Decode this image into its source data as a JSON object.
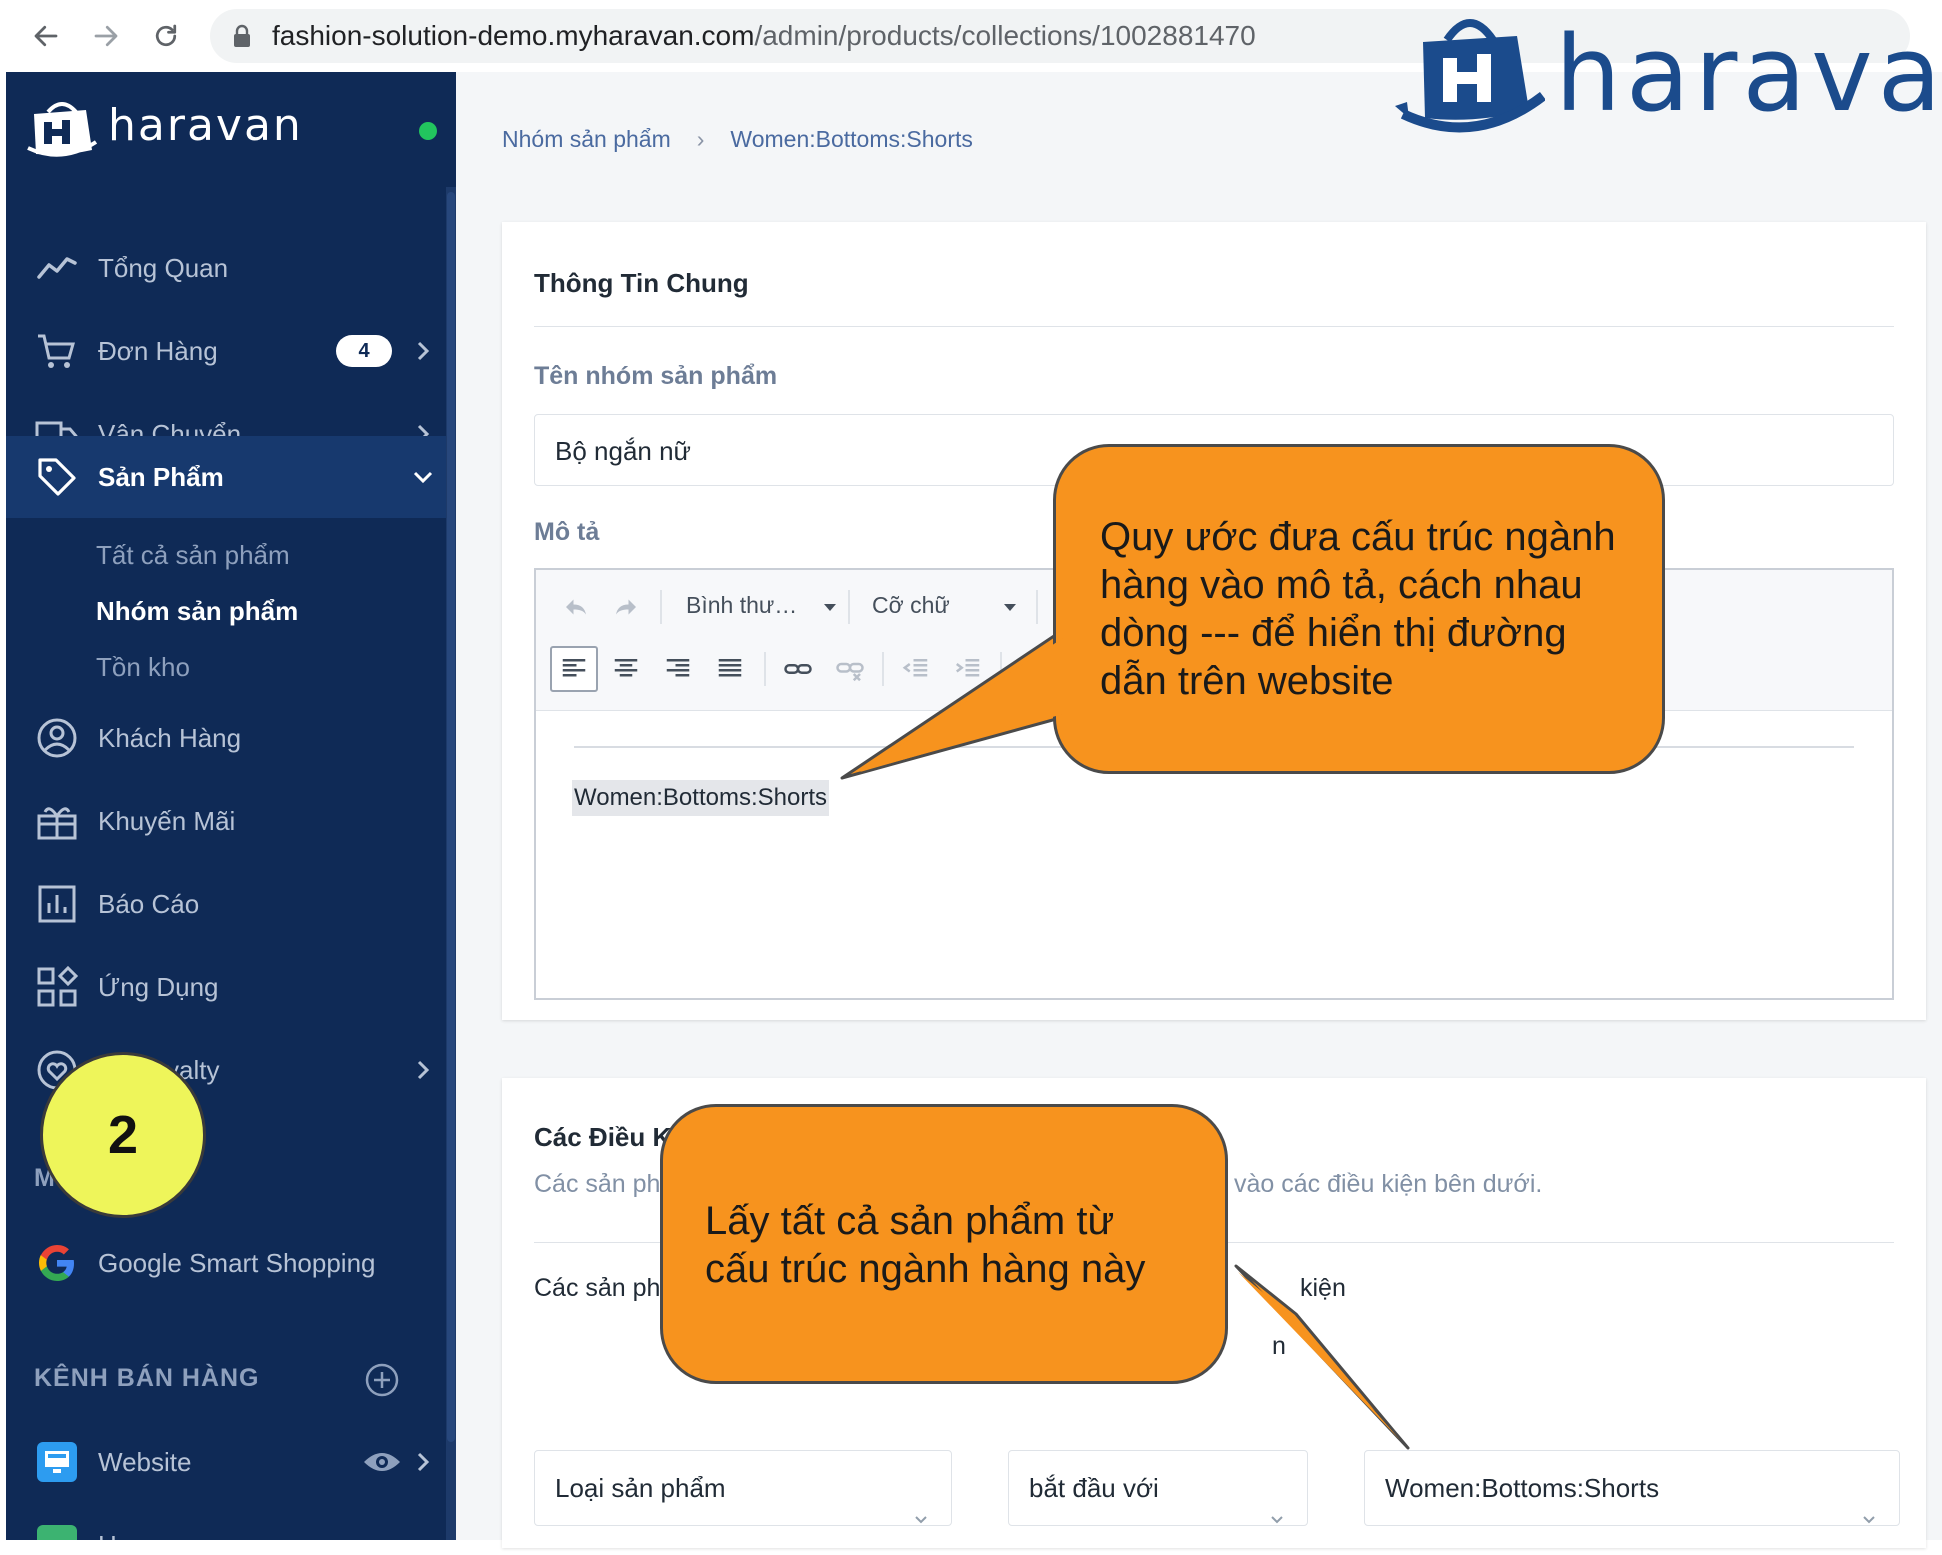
{
  "browser": {
    "url_host": "fashion-solution-demo.myharavan.com",
    "url_path": "/admin/products/collections/1002881470"
  },
  "brand": {
    "name": "haravan",
    "color": "#1b4b8c"
  },
  "sidebar": {
    "logo_text": "haravan",
    "status_color": "#22c55e",
    "items": [
      {
        "label": "Tổng Quan",
        "icon": "chart-line-icon"
      },
      {
        "label": "Đơn Hàng",
        "icon": "cart-icon",
        "badge": "4"
      },
      {
        "label": "Vận Chuyển",
        "icon": "truck-icon"
      },
      {
        "label": "Sản Phẩm",
        "icon": "tag-icon",
        "active": true
      },
      {
        "label": "Khách Hàng",
        "icon": "user-circle-icon"
      },
      {
        "label": "Khuyến Mãi",
        "icon": "gift-icon"
      },
      {
        "label": "Báo Cáo",
        "icon": "report-icon"
      },
      {
        "label": "Ứng Dụng",
        "icon": "apps-icon"
      },
      {
        "label": "yalty",
        "icon": "heart-icon"
      },
      {
        "label": "Google Smart Shopping",
        "icon": "google-icon"
      },
      {
        "label": "Website",
        "icon": "website-icon"
      },
      {
        "label": "Haravan...",
        "icon": "store-icon"
      }
    ],
    "sub_items": [
      "Tất cả sản phẩm",
      "Nhóm sản phẩm",
      "Tồn kho"
    ],
    "partial_section": "M",
    "sales_channels": "KÊNH BÁN HÀNG"
  },
  "breadcrumb": {
    "parent": "Nhóm sản phẩm",
    "current": "Women:Bottoms:Shorts"
  },
  "general": {
    "title": "Thông Tin Chung",
    "name_label": "Tên nhóm sản phẩm",
    "name_value": "Bộ ngắn nữ",
    "desc_label": "Mô tả",
    "toolbar": {
      "format": "Bình thư…",
      "font_size": "Cỡ chữ"
    },
    "desc_text": "Women:Bottoms:Shorts"
  },
  "conditions": {
    "title": "Các Điều Ki",
    "desc_left": "Các sản ph",
    "desc_right": "vào các điều kiện bên dưới.",
    "line_left": "Các sản ph",
    "line_right": "kiện",
    "fragment": "n",
    "field": "Loại sản phẩm",
    "operator": "bắt đầu với",
    "value": "Women:Bottoms:Shorts"
  },
  "callouts": {
    "top_lines": [
      "Quy ước đưa cấu trúc ngành",
      "hàng vào mô tả, cách nhau",
      "dòng --- để hiển thị đường",
      "dẫn trên website"
    ],
    "bottom_lines": [
      "Lấy tất cả sản phẩm từ",
      "cấu trúc ngành hàng này"
    ],
    "fill": "#f7931e"
  },
  "step_marker": "2"
}
